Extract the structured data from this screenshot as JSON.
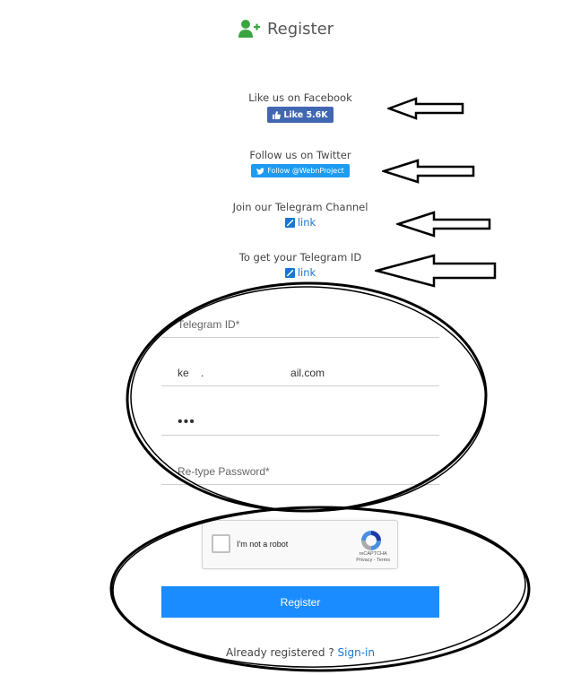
{
  "header": {
    "title": "Register",
    "icon": "user-plus-icon",
    "icon_color": "#3aa641"
  },
  "facebook": {
    "caption": "Like us on Facebook",
    "button_label": "Like 5.6K",
    "color": "#4267b2"
  },
  "twitter": {
    "caption": "Follow us on Twitter",
    "button_label": "Follow @WebnProject",
    "color": "#1d9bf0"
  },
  "telegram_channel": {
    "caption": "Join our Telegram Channel",
    "link_label": "link"
  },
  "telegram_id": {
    "caption": "To get your Telegram ID",
    "link_label": "link"
  },
  "form": {
    "telegram_id": {
      "value": "",
      "placeholder": "Telegram ID*"
    },
    "email": {
      "value": "ke    .                             ail.com",
      "placeholder": ""
    },
    "password": {
      "value": "•••",
      "placeholder": ""
    },
    "retype_password": {
      "value": "",
      "placeholder": "Re-type Password*"
    }
  },
  "recaptcha": {
    "label": "I'm not a robot",
    "brand": "reCAPTCHA",
    "links": "Privacy - Terms"
  },
  "submit": {
    "label": "Register",
    "color": "#1a8cff"
  },
  "footer": {
    "text": "Already registered ? ",
    "link": "Sign-in"
  },
  "link_color": "#1877d2"
}
